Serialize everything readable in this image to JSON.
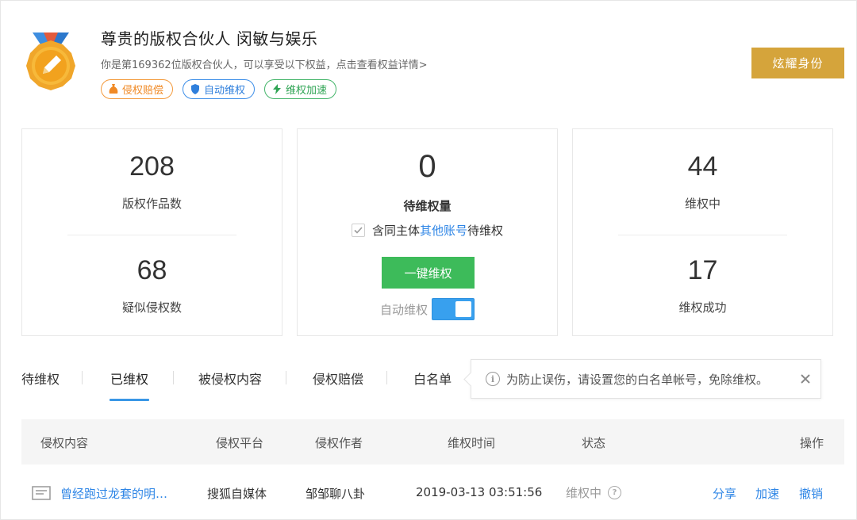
{
  "header": {
    "title": "尊贵的版权合伙人 闵敏与娱乐",
    "subtitle": "你是第169362位版权合伙人，可以享受以下权益，点击查看权益详情>",
    "tags": [
      {
        "label": "侵权赔偿",
        "icon": "money-bag-icon",
        "color": "#f08a26"
      },
      {
        "label": "自动维权",
        "icon": "shield-icon",
        "color": "#2f7fdc"
      },
      {
        "label": "维权加速",
        "icon": "lightning-icon",
        "color": "#2fa454"
      }
    ],
    "show_button": "炫耀身份"
  },
  "stats": {
    "works_count": "208",
    "works_label": "版权作品数",
    "suspected_count": "68",
    "suspected_label": "疑似侵权数",
    "pending_count": "0",
    "pending_label": "待维权量",
    "include_prefix": "含同主体",
    "include_link": "其他账号",
    "include_suffix": "待维权",
    "include_checked": true,
    "oneclick_button": "一键维权",
    "auto_label": "自动维权",
    "auto_on": true,
    "in_progress_count": "44",
    "in_progress_label": "维权中",
    "success_count": "17",
    "success_label": "维权成功"
  },
  "tabs": [
    {
      "label": "待维权",
      "active": false
    },
    {
      "label": "已维权",
      "active": true
    },
    {
      "label": "被侵权内容",
      "active": false
    },
    {
      "label": "侵权赔偿",
      "active": false
    },
    {
      "label": "白名单",
      "active": false
    }
  ],
  "tooltip": {
    "text": "为防止误伤，请设置您的白名单帐号，免除维权。"
  },
  "table": {
    "columns": [
      "侵权内容",
      "侵权平台",
      "侵权作者",
      "维权时间",
      "状态",
      "操作"
    ],
    "rows": [
      {
        "content": "曾经跑过龙套的明…",
        "platform": "搜狐自媒体",
        "author": "邹邹聊八卦",
        "time": "2019-03-13 03:51:56",
        "status": "维权中",
        "actions": [
          "分享",
          "加速",
          "撤销"
        ]
      }
    ]
  },
  "colors": {
    "gold": "#d5a43b",
    "green": "#3dbb5a",
    "blue": "#2f86e6",
    "toggle": "#38a0ee"
  }
}
